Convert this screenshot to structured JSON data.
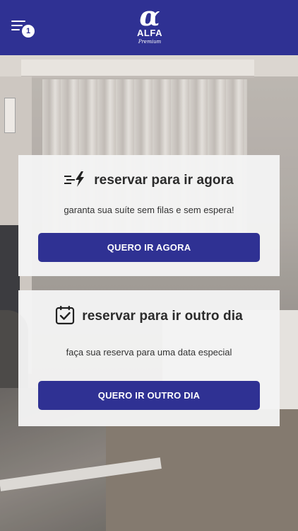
{
  "header": {
    "menu_badge": "1",
    "logo": {
      "symbol": "α",
      "name": "ALFA",
      "tagline": "Premium"
    },
    "colors": {
      "bar": "#2f3193",
      "text": "#ffffff"
    }
  },
  "cards": {
    "now": {
      "icon": "fast-lightning-icon",
      "title": "reservar para ir agora",
      "subtitle": "garanta sua suíte sem filas e sem espera!",
      "button": "QUERO IR AGORA"
    },
    "other": {
      "icon": "calendar-check-icon",
      "title": "reservar para ir outro dia",
      "subtitle": "faça sua reserva para uma data especial",
      "button": "QUERO IR OUTRO DIA"
    }
  },
  "colors": {
    "accent": "#2f3193",
    "card_bg": "#f4f4f4"
  }
}
